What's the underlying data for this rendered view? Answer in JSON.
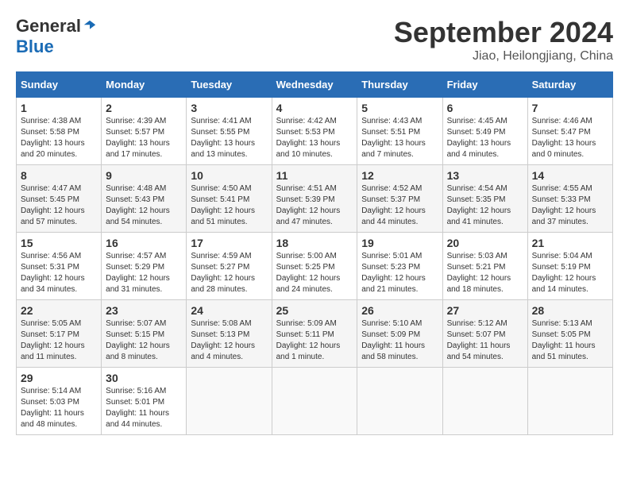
{
  "logo": {
    "general": "General",
    "blue": "Blue"
  },
  "header": {
    "title": "September 2024",
    "subtitle": "Jiao, Heilongjiang, China"
  },
  "weekdays": [
    "Sunday",
    "Monday",
    "Tuesday",
    "Wednesday",
    "Thursday",
    "Friday",
    "Saturday"
  ],
  "weeks": [
    [
      {
        "day": "1",
        "sunrise": "4:38 AM",
        "sunset": "5:58 PM",
        "daylight": "13 hours and 20 minutes."
      },
      {
        "day": "2",
        "sunrise": "4:39 AM",
        "sunset": "5:57 PM",
        "daylight": "13 hours and 17 minutes."
      },
      {
        "day": "3",
        "sunrise": "4:41 AM",
        "sunset": "5:55 PM",
        "daylight": "13 hours and 13 minutes."
      },
      {
        "day": "4",
        "sunrise": "4:42 AM",
        "sunset": "5:53 PM",
        "daylight": "13 hours and 10 minutes."
      },
      {
        "day": "5",
        "sunrise": "4:43 AM",
        "sunset": "5:51 PM",
        "daylight": "13 hours and 7 minutes."
      },
      {
        "day": "6",
        "sunrise": "4:45 AM",
        "sunset": "5:49 PM",
        "daylight": "13 hours and 4 minutes."
      },
      {
        "day": "7",
        "sunrise": "4:46 AM",
        "sunset": "5:47 PM",
        "daylight": "13 hours and 0 minutes."
      }
    ],
    [
      {
        "day": "8",
        "sunrise": "4:47 AM",
        "sunset": "5:45 PM",
        "daylight": "12 hours and 57 minutes."
      },
      {
        "day": "9",
        "sunrise": "4:48 AM",
        "sunset": "5:43 PM",
        "daylight": "12 hours and 54 minutes."
      },
      {
        "day": "10",
        "sunrise": "4:50 AM",
        "sunset": "5:41 PM",
        "daylight": "12 hours and 51 minutes."
      },
      {
        "day": "11",
        "sunrise": "4:51 AM",
        "sunset": "5:39 PM",
        "daylight": "12 hours and 47 minutes."
      },
      {
        "day": "12",
        "sunrise": "4:52 AM",
        "sunset": "5:37 PM",
        "daylight": "12 hours and 44 minutes."
      },
      {
        "day": "13",
        "sunrise": "4:54 AM",
        "sunset": "5:35 PM",
        "daylight": "12 hours and 41 minutes."
      },
      {
        "day": "14",
        "sunrise": "4:55 AM",
        "sunset": "5:33 PM",
        "daylight": "12 hours and 37 minutes."
      }
    ],
    [
      {
        "day": "15",
        "sunrise": "4:56 AM",
        "sunset": "5:31 PM",
        "daylight": "12 hours and 34 minutes."
      },
      {
        "day": "16",
        "sunrise": "4:57 AM",
        "sunset": "5:29 PM",
        "daylight": "12 hours and 31 minutes."
      },
      {
        "day": "17",
        "sunrise": "4:59 AM",
        "sunset": "5:27 PM",
        "daylight": "12 hours and 28 minutes."
      },
      {
        "day": "18",
        "sunrise": "5:00 AM",
        "sunset": "5:25 PM",
        "daylight": "12 hours and 24 minutes."
      },
      {
        "day": "19",
        "sunrise": "5:01 AM",
        "sunset": "5:23 PM",
        "daylight": "12 hours and 21 minutes."
      },
      {
        "day": "20",
        "sunrise": "5:03 AM",
        "sunset": "5:21 PM",
        "daylight": "12 hours and 18 minutes."
      },
      {
        "day": "21",
        "sunrise": "5:04 AM",
        "sunset": "5:19 PM",
        "daylight": "12 hours and 14 minutes."
      }
    ],
    [
      {
        "day": "22",
        "sunrise": "5:05 AM",
        "sunset": "5:17 PM",
        "daylight": "12 hours and 11 minutes."
      },
      {
        "day": "23",
        "sunrise": "5:07 AM",
        "sunset": "5:15 PM",
        "daylight": "12 hours and 8 minutes."
      },
      {
        "day": "24",
        "sunrise": "5:08 AM",
        "sunset": "5:13 PM",
        "daylight": "12 hours and 4 minutes."
      },
      {
        "day": "25",
        "sunrise": "5:09 AM",
        "sunset": "5:11 PM",
        "daylight": "12 hours and 1 minute."
      },
      {
        "day": "26",
        "sunrise": "5:10 AM",
        "sunset": "5:09 PM",
        "daylight": "11 hours and 58 minutes."
      },
      {
        "day": "27",
        "sunrise": "5:12 AM",
        "sunset": "5:07 PM",
        "daylight": "11 hours and 54 minutes."
      },
      {
        "day": "28",
        "sunrise": "5:13 AM",
        "sunset": "5:05 PM",
        "daylight": "11 hours and 51 minutes."
      }
    ],
    [
      {
        "day": "29",
        "sunrise": "5:14 AM",
        "sunset": "5:03 PM",
        "daylight": "11 hours and 48 minutes."
      },
      {
        "day": "30",
        "sunrise": "5:16 AM",
        "sunset": "5:01 PM",
        "daylight": "11 hours and 44 minutes."
      },
      null,
      null,
      null,
      null,
      null
    ]
  ]
}
